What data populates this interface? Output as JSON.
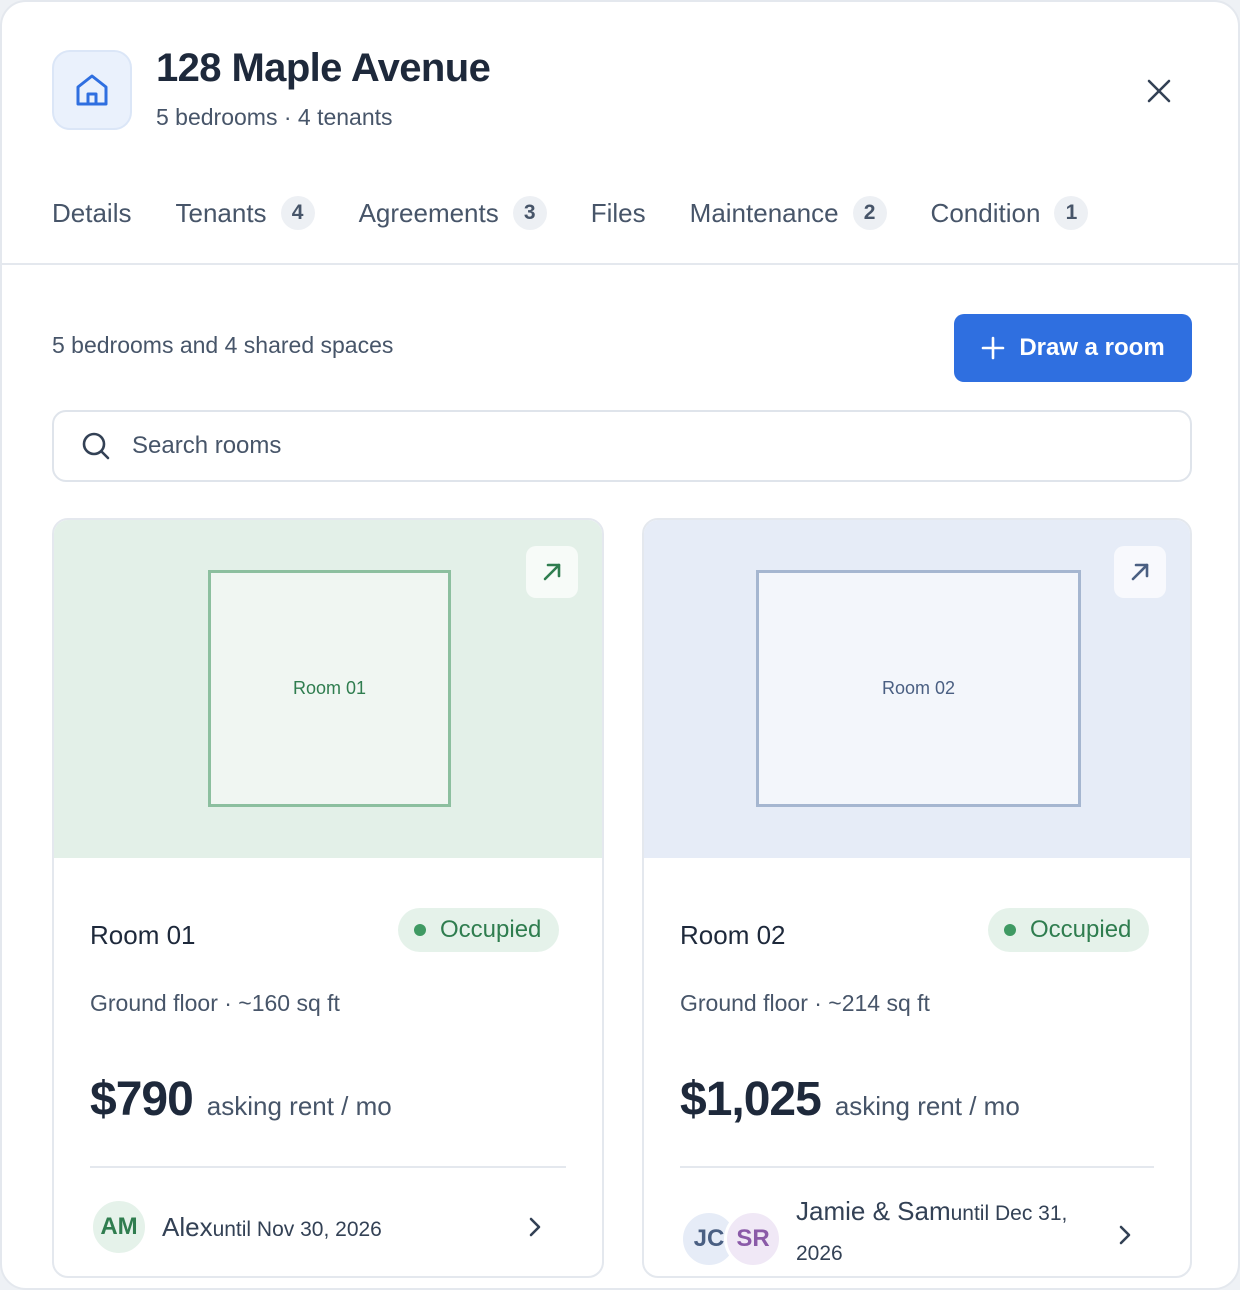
{
  "header": {
    "title": "128 Maple Avenue",
    "subtitle": "5 bedrooms · 4 tenants",
    "icon": "home-icon",
    "close_icon": "close-icon"
  },
  "tabs": [
    {
      "label": "Details",
      "count": ""
    },
    {
      "label": "Tenants",
      "count": "4"
    },
    {
      "label": "Agreements",
      "count": "3"
    },
    {
      "label": "Files",
      "count": ""
    },
    {
      "label": "Maintenance",
      "count": "2"
    },
    {
      "label": "Condition",
      "count": "1"
    }
  ],
  "toolbar": {
    "summary": "5 bedrooms and 4 shared spaces",
    "draw_button_label": "Draw a room",
    "draw_button_icon": "plus-icon"
  },
  "search": {
    "placeholder": "Search rooms",
    "value": "",
    "icon": "search-icon"
  },
  "rooms": [
    {
      "plan_label": "Room 01",
      "name": "Room 01",
      "status": "Occupied",
      "meta": "Ground floor · ~160 sq ft",
      "rent": "$790",
      "rent_label": "asking rent / mo",
      "tenants": [
        {
          "initials": "AM"
        }
      ],
      "tenant_name": "Alex",
      "tenant_until": "until Nov 30, 2026"
    },
    {
      "plan_label": "Room 02",
      "name": "Room 02",
      "status": "Occupied",
      "meta": "Ground floor · ~214 sq ft",
      "rent": "$1,025",
      "rent_label": "asking rent / mo",
      "tenants": [
        {
          "initials": "JC"
        },
        {
          "initials": "SR"
        }
      ],
      "tenant_name": "Jamie & Sam",
      "tenant_until": "until Dec 31, 2026"
    }
  ],
  "colors": {
    "accent": "#2f6fe0",
    "room1_plan_bg": "#e3f0e8",
    "room2_plan_bg": "#e6ecf7",
    "occupied": "#2f7d4f"
  }
}
